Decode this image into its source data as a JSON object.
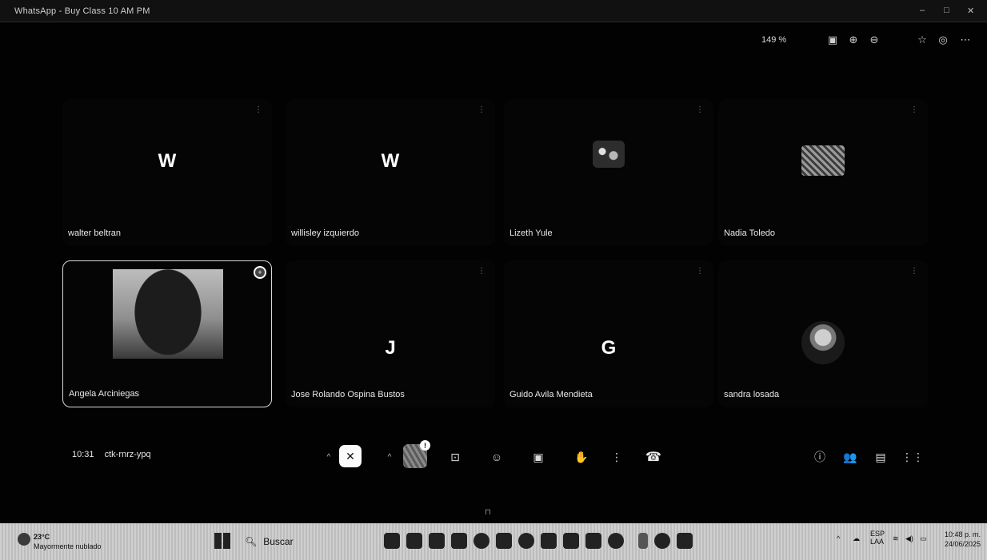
{
  "window": {
    "title": "WhatsApp - Buy Class 10 AM PM",
    "controls": [
      "–",
      "□",
      "✕"
    ]
  },
  "toolbar": {
    "zoom_level": "149 %",
    "icons": [
      "reader-icon",
      "zoom-in-icon",
      "zoom-out-icon",
      "favorite-star-icon",
      "profile-icon",
      "more-icon"
    ]
  },
  "participants": [
    {
      "name": "walter beltran",
      "initial": "W",
      "avatar": "letter"
    },
    {
      "name": "willisley izquierdo",
      "initial": "W",
      "avatar": "letter"
    },
    {
      "name": "Lizeth Yule",
      "initial": "",
      "avatar": "image"
    },
    {
      "name": "Nadia Toledo",
      "initial": "",
      "avatar": "image"
    },
    {
      "name": "Angela Arciniegas",
      "initial": "",
      "avatar": "video"
    },
    {
      "name": "Jose Rolando Ospina Bustos",
      "initial": "J",
      "avatar": "letter"
    },
    {
      "name": "Guido Avila Mendieta",
      "initial": "G",
      "avatar": "letter"
    },
    {
      "name": "sandra losada",
      "initial": "",
      "avatar": "photo"
    }
  ],
  "meeting": {
    "time": "10:31",
    "code": "ctk-rnrz-ypq",
    "notification_badge": "!"
  },
  "taskbar": {
    "weather_temp": "23°C",
    "weather_desc": "Mayormente nublado",
    "search_label": "Buscar",
    "tray_language": "ESP",
    "tray_region": "LAA",
    "clock_time": "10:48 p. m.",
    "clock_date": "24/06/2025"
  }
}
